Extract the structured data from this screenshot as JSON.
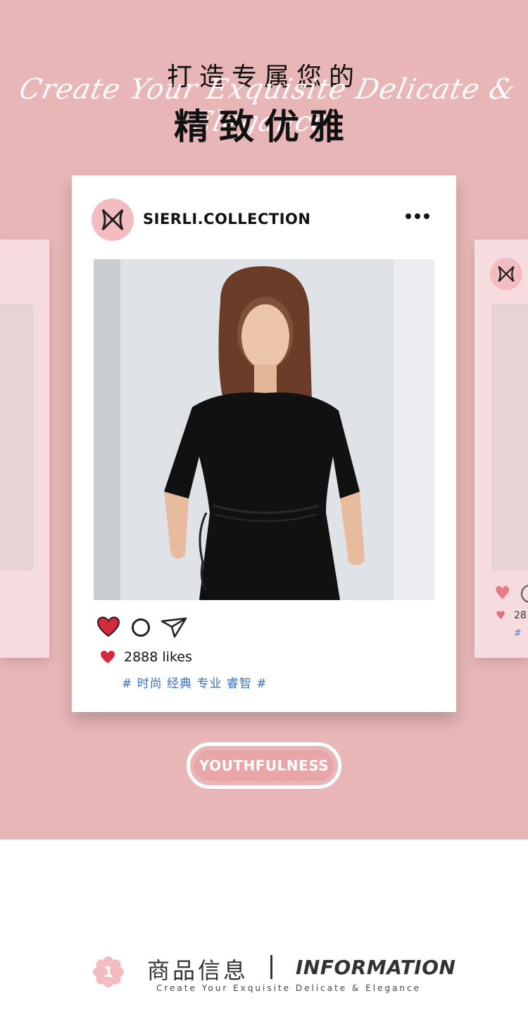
{
  "hero": {
    "script_text": "Create Your Exquisite Delicate & Elegance",
    "title_line1": "打造专属您的",
    "title_line2": "精致优雅"
  },
  "post": {
    "username": "SIERLI.COLLECTION",
    "likes": "2888 likes",
    "tags": "# 时尚 经典 专业 睿智 #",
    "icons": [
      "heart-icon",
      "comment-icon",
      "share-icon",
      "more-icon"
    ]
  },
  "side_post": {
    "likes": "28",
    "tags": "#"
  },
  "pill": {
    "label": "YOUTHFULNESS"
  },
  "info": {
    "number": "1",
    "title_cn": "商品信息",
    "title_en": "INFORMATION",
    "subtitle": "Create Your Exquisite Delicate & Elegance"
  },
  "colors": {
    "hero_bg": "#e8b6b7",
    "accent_pink": "#e8a6a9",
    "heart_red": "#d6293f",
    "tag_blue": "#3b6fbf",
    "avatar_pink": "#f2bcc0"
  }
}
